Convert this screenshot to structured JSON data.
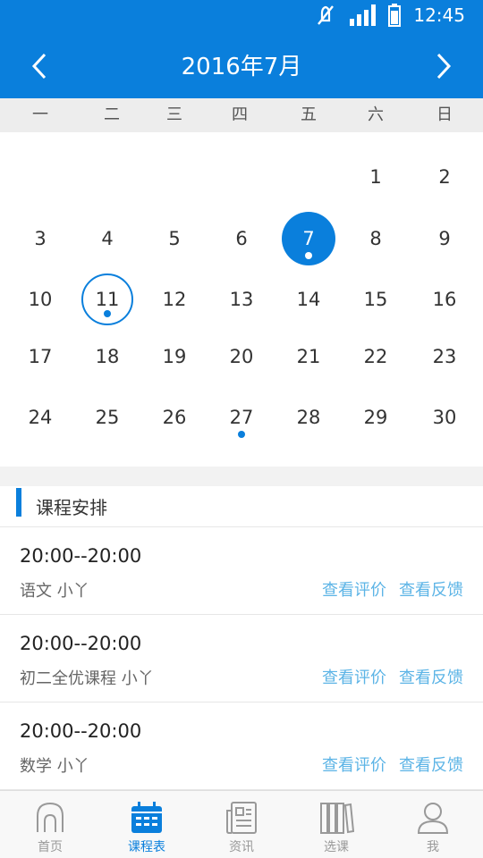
{
  "status_bar": {
    "time": "12:45"
  },
  "header": {
    "title": "2016年7月"
  },
  "weekdays": [
    "一",
    "二",
    "三",
    "四",
    "五",
    "六",
    "日"
  ],
  "calendar": {
    "days": [
      "1",
      "2",
      "3",
      "4",
      "5",
      "6",
      "7",
      "8",
      "9",
      "10",
      "11",
      "12",
      "13",
      "14",
      "15",
      "16",
      "17",
      "18",
      "19",
      "20",
      "21",
      "22",
      "23",
      "24",
      "25",
      "26",
      "27",
      "28",
      "29",
      "30"
    ],
    "selected_day": "7",
    "today_day": "11",
    "days_with_courses": [
      "7",
      "11",
      "27"
    ]
  },
  "section": {
    "title": "课程安排"
  },
  "courses": [
    {
      "time": "20:00--20:00",
      "info": "语文  小丫",
      "review_label": "查看评价",
      "feedback_label": "查看反馈"
    },
    {
      "time": "20:00--20:00",
      "info": "初二全优课程  小丫",
      "review_label": "查看评价",
      "feedback_label": "查看反馈"
    },
    {
      "time": "20:00--20:00",
      "info": "数学  小丫",
      "review_label": "查看评价",
      "feedback_label": "查看反馈"
    }
  ],
  "tabs": [
    {
      "label": "首页",
      "icon": "home-icon"
    },
    {
      "label": "课程表",
      "icon": "calendar-icon",
      "active": true
    },
    {
      "label": "资讯",
      "icon": "news-icon"
    },
    {
      "label": "选课",
      "icon": "books-icon"
    },
    {
      "label": "我",
      "icon": "user-icon"
    }
  ],
  "colors": {
    "accent": "#0a7fdc",
    "link": "#5cb4e6"
  }
}
